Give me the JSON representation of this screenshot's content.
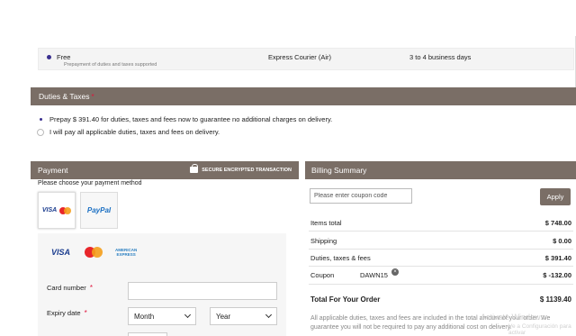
{
  "shipping": {
    "option_name": "Free",
    "option_sub": "Prepayment of duties and taxes supported",
    "carrier": "Express Courier (Air)",
    "delivery_time": "3 to 4 business days"
  },
  "duties": {
    "title": "Duties & Taxes",
    "required_mark": "*",
    "option_prepay": "Prepay $ 391.40 for duties, taxes and fees now to guarantee no additional charges on delivery.",
    "option_pay_later": "I will pay all applicable duties, taxes and fees on delivery.",
    "selected": "prepay"
  },
  "payment": {
    "title": "Payment",
    "secure_label": "SECURE ENCRYPTED TRANSACTION",
    "choose_label": "Please choose your payment method",
    "method_card_visa": "VISA",
    "method_paypal": "PayPal",
    "brand_visa": "VISA",
    "brand_amex_line1": "AMERICAN",
    "brand_amex_line2": "EXPRESS",
    "card_number_label": "Card number",
    "expiry_label": "Expiry date",
    "required_mark": "*",
    "month_value": "Month",
    "year_value": "Year"
  },
  "billing": {
    "title": "Billing Summary",
    "coupon_placeholder": "Please enter coupon code",
    "apply_label": "Apply",
    "items_total_label": "Items total",
    "items_total_value": "$ 748.00",
    "shipping_label": "Shipping",
    "shipping_value": "$ 0.00",
    "duties_label": "Duties, taxes & fees",
    "duties_value": "$ 391.40",
    "coupon_label": "Coupon",
    "coupon_code": "DAWN15",
    "coupon_remove": "×",
    "coupon_value": "$ -132.00",
    "total_label": "Total For Your Order",
    "total_value": "$ 1139.40",
    "disclaimer": "All applicable duties, taxes and fees are included in the total amount of your order. We guarantee you will not be required to pay any additional cost on delivery."
  },
  "watermark": {
    "line1": "Activate Windows",
    "line2": "Ve a Configuración para activar"
  },
  "colors": {
    "section_bar": "#7a6e66",
    "radio_selected": "#3a2f8f",
    "required": "#e0143c"
  }
}
